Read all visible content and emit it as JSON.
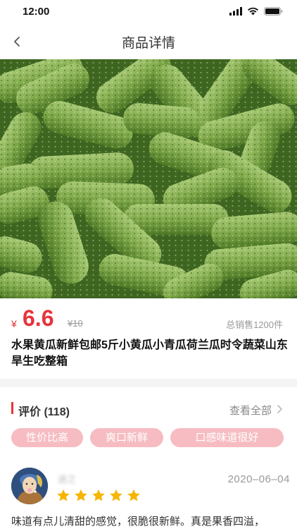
{
  "status_bar": {
    "time": "12:00"
  },
  "nav": {
    "title": "商品详情"
  },
  "product": {
    "currency": "¥",
    "price": "6.6",
    "original_price": "¥10",
    "sales": "总销售1200件",
    "title": "水果黄瓜新鲜包邮5斤小黄瓜小青瓜荷兰瓜时令蔬菜山东旱生吃整箱"
  },
  "reviews": {
    "title": "评价 (118)",
    "view_all": "查看全部",
    "tags": [
      "性价比高",
      "爽口新鲜",
      "口感味道很好"
    ],
    "items": [
      {
        "user": "迷之",
        "date": "2020–06–04",
        "rating": 5,
        "text": "味道有点儿清甜的感觉，很脆很新鲜。真是果香四溢，"
      }
    ]
  },
  "colors": {
    "accent": "#e8333b",
    "tag_bg": "#f6bcc1",
    "star": "#f7b500"
  }
}
